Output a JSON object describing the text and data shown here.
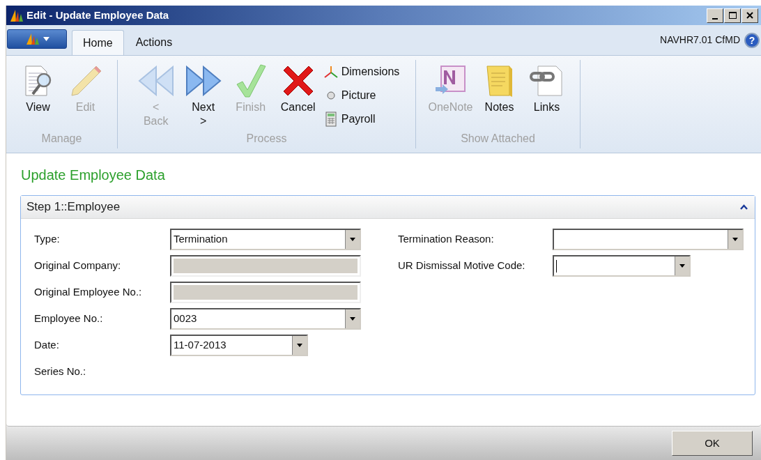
{
  "window": {
    "title": "Edit - Update Employee Data"
  },
  "tabs": [
    {
      "label": "Home",
      "selected": true
    },
    {
      "label": "Actions",
      "selected": false
    }
  ],
  "server_label": "NAVHR7.01 CfMD",
  "help_label": "?",
  "ribbon_groups": [
    {
      "label": "Manage",
      "buttons": [
        {
          "label": "View",
          "disabled": false,
          "kind": "large"
        },
        {
          "label": "Edit",
          "disabled": true,
          "kind": "large"
        }
      ]
    },
    {
      "label": "Process",
      "buttons": [
        {
          "label": "< Back",
          "disabled": true,
          "kind": "large"
        },
        {
          "label": "Next >",
          "disabled": false,
          "kind": "large"
        },
        {
          "label": "Finish",
          "disabled": true,
          "kind": "large"
        },
        {
          "label": "Cancel",
          "disabled": false,
          "kind": "large"
        },
        {
          "label": "Dimensions",
          "disabled": false,
          "kind": "small"
        },
        {
          "label": "Picture",
          "disabled": false,
          "kind": "small"
        },
        {
          "label": "Payroll",
          "disabled": false,
          "kind": "small"
        }
      ]
    },
    {
      "label": "Show Attached",
      "buttons": [
        {
          "label": "OneNote",
          "disabled": true,
          "kind": "large"
        },
        {
          "label": "Notes",
          "disabled": false,
          "kind": "large"
        },
        {
          "label": "Links",
          "disabled": false,
          "kind": "large"
        }
      ]
    }
  ],
  "page_title": "Update Employee Data",
  "section": {
    "title": "Step 1::Employee",
    "expanded": true,
    "left_fields": [
      {
        "label": "Type:",
        "kind": "dropdown",
        "value": "Termination"
      },
      {
        "label": "Original Company:",
        "kind": "locked"
      },
      {
        "label": "Original Employee No.:",
        "kind": "locked"
      },
      {
        "label": "Employee No.:",
        "kind": "dropdown",
        "value": "0023"
      },
      {
        "label": "Date:",
        "kind": "date",
        "value": "11-07-2013"
      },
      {
        "label": "Series No.:",
        "kind": "none"
      }
    ],
    "right_fields": [
      {
        "label": "Termination Reason:",
        "kind": "dropdown",
        "focused": false
      },
      {
        "label": "UR Dismissal Motive Code:",
        "kind": "short",
        "focused": true
      }
    ]
  },
  "buttons": [
    "OK"
  ]
}
